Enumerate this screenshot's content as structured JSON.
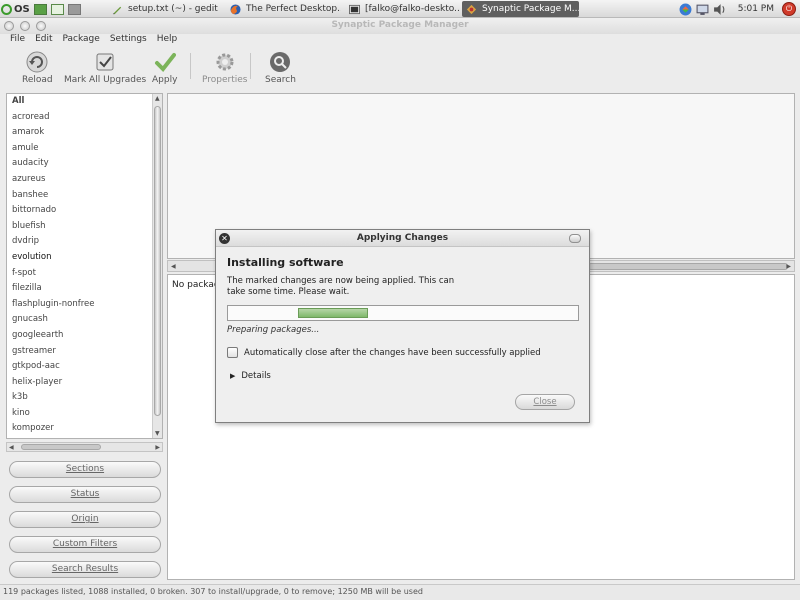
{
  "taskbar": {
    "os_label": "OS",
    "tasks": [
      {
        "label": "setup.txt (~) - gedit",
        "icon": "gedit-icon"
      },
      {
        "label": "The Perfect Desktop...",
        "icon": "firefox-icon"
      },
      {
        "label": "[falko@falko-deskto...",
        "icon": "terminal-icon"
      },
      {
        "label": "Synaptic Package M...",
        "icon": "synaptic-icon"
      }
    ],
    "clock": "5:01 PM"
  },
  "window": {
    "title": "Synaptic Package Manager"
  },
  "menu": [
    "File",
    "Edit",
    "Package",
    "Settings",
    "Help"
  ],
  "toolbar": {
    "reload": "Reload",
    "mark_all": "Mark All Upgrades",
    "apply": "Apply",
    "properties": "Properties",
    "search": "Search"
  },
  "packages": [
    "All",
    "acroread",
    "amarok",
    "amule",
    "audacity",
    "azureus",
    "banshee",
    "bittornado",
    "bluefish",
    "dvdrip",
    "evolution",
    "f-spot",
    "filezilla",
    "flashplugin-nonfree",
    "gnucash",
    "googleearth",
    "gstreamer",
    "gtkpod-aac",
    "helix-player",
    "k3b",
    "kino",
    "kompozer"
  ],
  "filters": {
    "sections": "Sections",
    "status": "Status",
    "origin": "Origin",
    "custom": "Custom Filters",
    "search_results": "Search Results"
  },
  "lower_pane": {
    "no_package": "No package"
  },
  "status_bar": "119 packages listed, 1088 installed, 0 broken. 307 to install/upgrade, 0 to remove; 1250 MB will be used",
  "dialog": {
    "title": "Applying Changes",
    "heading": "Installing software",
    "description": "The marked changes are now being applied. This can take some time. Please wait.",
    "progress_status": "Preparing packages...",
    "auto_close_label": "Automatically close after the changes have been successfully applied",
    "details_label": "Details",
    "close_label": "Close",
    "progress_indicator": {
      "start_fraction": 0.2,
      "end_fraction": 0.4
    }
  }
}
